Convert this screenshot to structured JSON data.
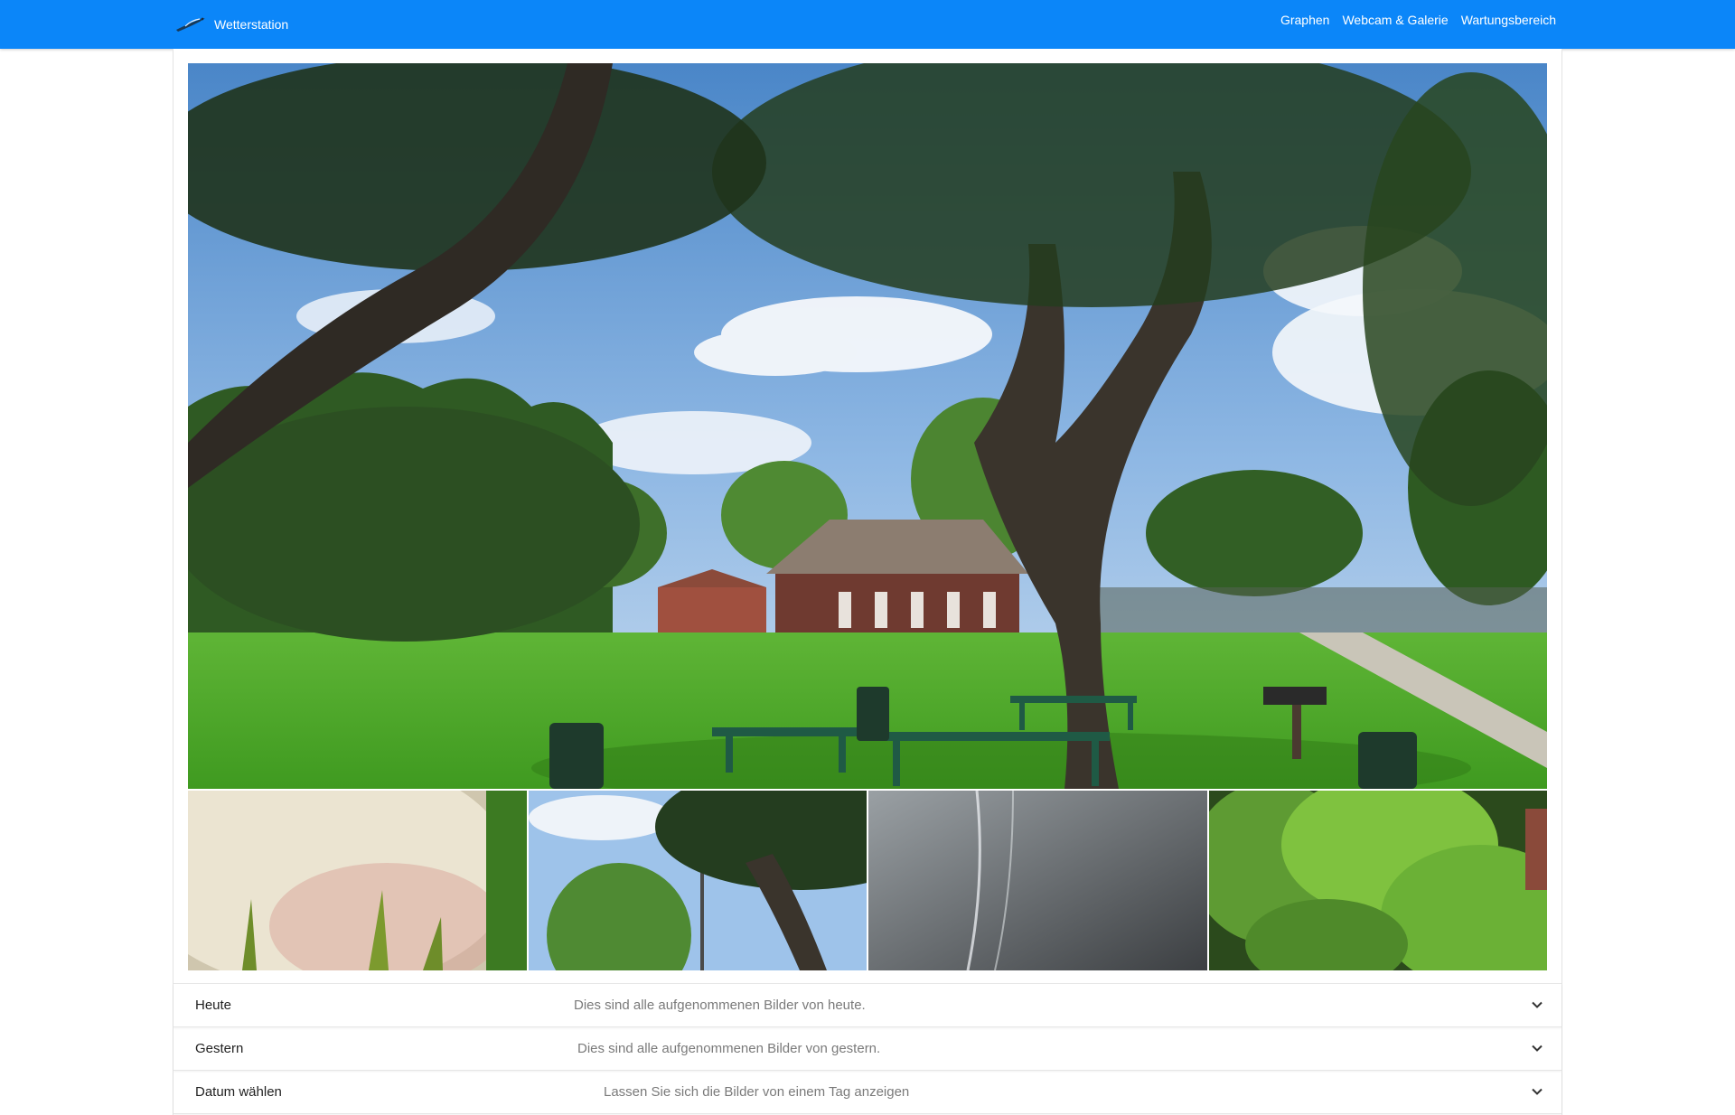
{
  "colors": {
    "navbar": "#0b86f9",
    "text": "#222222",
    "muted": "#7a7a7a"
  },
  "navbar": {
    "brand": "Wetterstation",
    "brand_icon": "bird-logo-icon",
    "links": [
      {
        "label": "Graphen"
      },
      {
        "label": "Webcam & Galerie"
      },
      {
        "label": "Wartungsbereich"
      }
    ]
  },
  "gallery": {
    "main_image": "park-with-trees-picnic-tables-barn",
    "thumbnails": [
      {
        "subject": "white-fur-closeup"
      },
      {
        "subject": "tree-and-sky"
      },
      {
        "subject": "blurry-grey-lens"
      },
      {
        "subject": "green-foliage"
      }
    ]
  },
  "accordion": [
    {
      "title": "Heute",
      "description": "Dies sind alle aufgenommenen Bilder von heute.",
      "icon": "chevron-down-icon"
    },
    {
      "title": "Gestern",
      "description": "Dies sind alle aufgenommenen Bilder von gestern.",
      "icon": "chevron-down-icon"
    },
    {
      "title": "Datum wählen",
      "description": "Lassen Sie sich die Bilder von einem Tag anzeigen",
      "icon": "chevron-down-icon"
    }
  ]
}
